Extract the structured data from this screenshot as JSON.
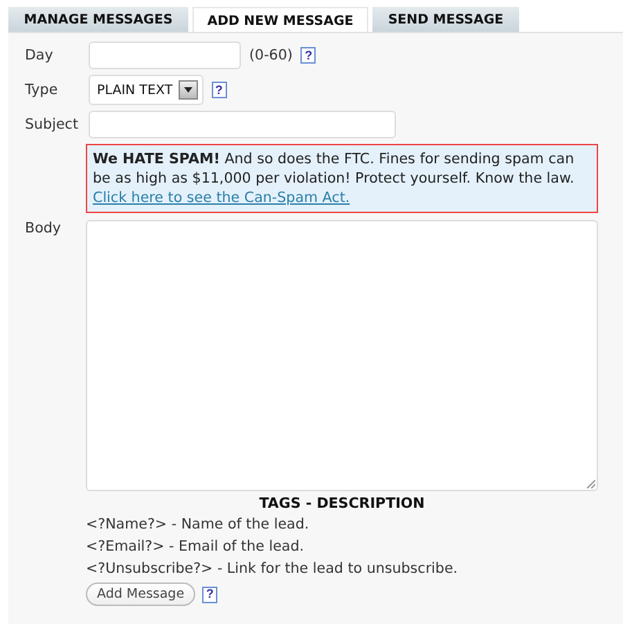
{
  "tabs": [
    {
      "label": "MANAGE MESSAGES",
      "selected": false
    },
    {
      "label": "ADD NEW MESSAGE",
      "selected": true
    },
    {
      "label": "SEND MESSAGE",
      "selected": false
    }
  ],
  "form": {
    "day": {
      "label": "Day",
      "range": "(0-60)",
      "help": "?"
    },
    "type": {
      "label": "Type",
      "value": "PLAIN TEXT",
      "help": "?"
    },
    "subject": {
      "label": "Subject"
    },
    "notice": {
      "text": "**We HATE SPAM!** And so does the FTC. Fines for sending spam can be as high as $11,000 per violation! Protect yourself. Know the law.",
      "link": "Click here to see the Can-Spam Act."
    },
    "body": {
      "label": "Body"
    }
  },
  "tags": {
    "heading": "TAGS - DESCRIPTION",
    "items": [
      "<?Name?> - Name of the lead.",
      "<?Email?> - Email of the lead.",
      "<?Unsubscribe?> - Link for the lead to unsubscribe."
    ]
  },
  "submit": {
    "label": "Add Message",
    "help": "?"
  }
}
